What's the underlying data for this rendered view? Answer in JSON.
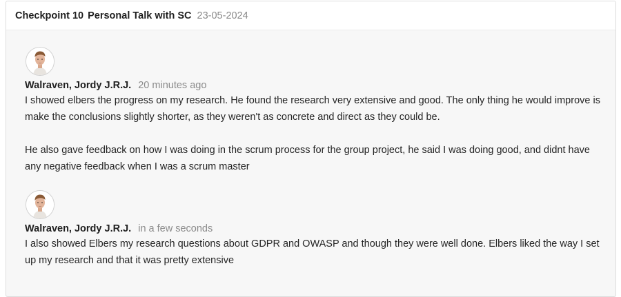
{
  "checkpoint": {
    "number_label": "Checkpoint 10",
    "title": "Personal Talk with SC",
    "date": "23-05-2024"
  },
  "comments": [
    {
      "author": "Walraven, Jordy J.R.J.",
      "time": "20 minutes ago",
      "paragraphs": [
        "I showed elbers the progress on my research. He found the research very extensive and good. The only thing he would improve is make the conclusions slightly shorter, as they weren't as concrete and direct as they could be.",
        "He also gave feedback on how I was doing in the scrum process for the group project, he said I was doing good, and didnt have any negative feedback when I was a scrum master"
      ]
    },
    {
      "author": "Walraven, Jordy J.R.J.",
      "time": "in a few seconds",
      "paragraphs": [
        "I also showed Elbers my research questions about GDPR and OWASP and though they were well done. Elbers liked the way I set up my research and that it was pretty extensive"
      ]
    }
  ],
  "colors": {
    "panel_background": "#f7f7f7",
    "muted_text": "#8a8a8a",
    "primary_text": "#222222"
  },
  "icons": {
    "avatar": "user-avatar-icon"
  }
}
